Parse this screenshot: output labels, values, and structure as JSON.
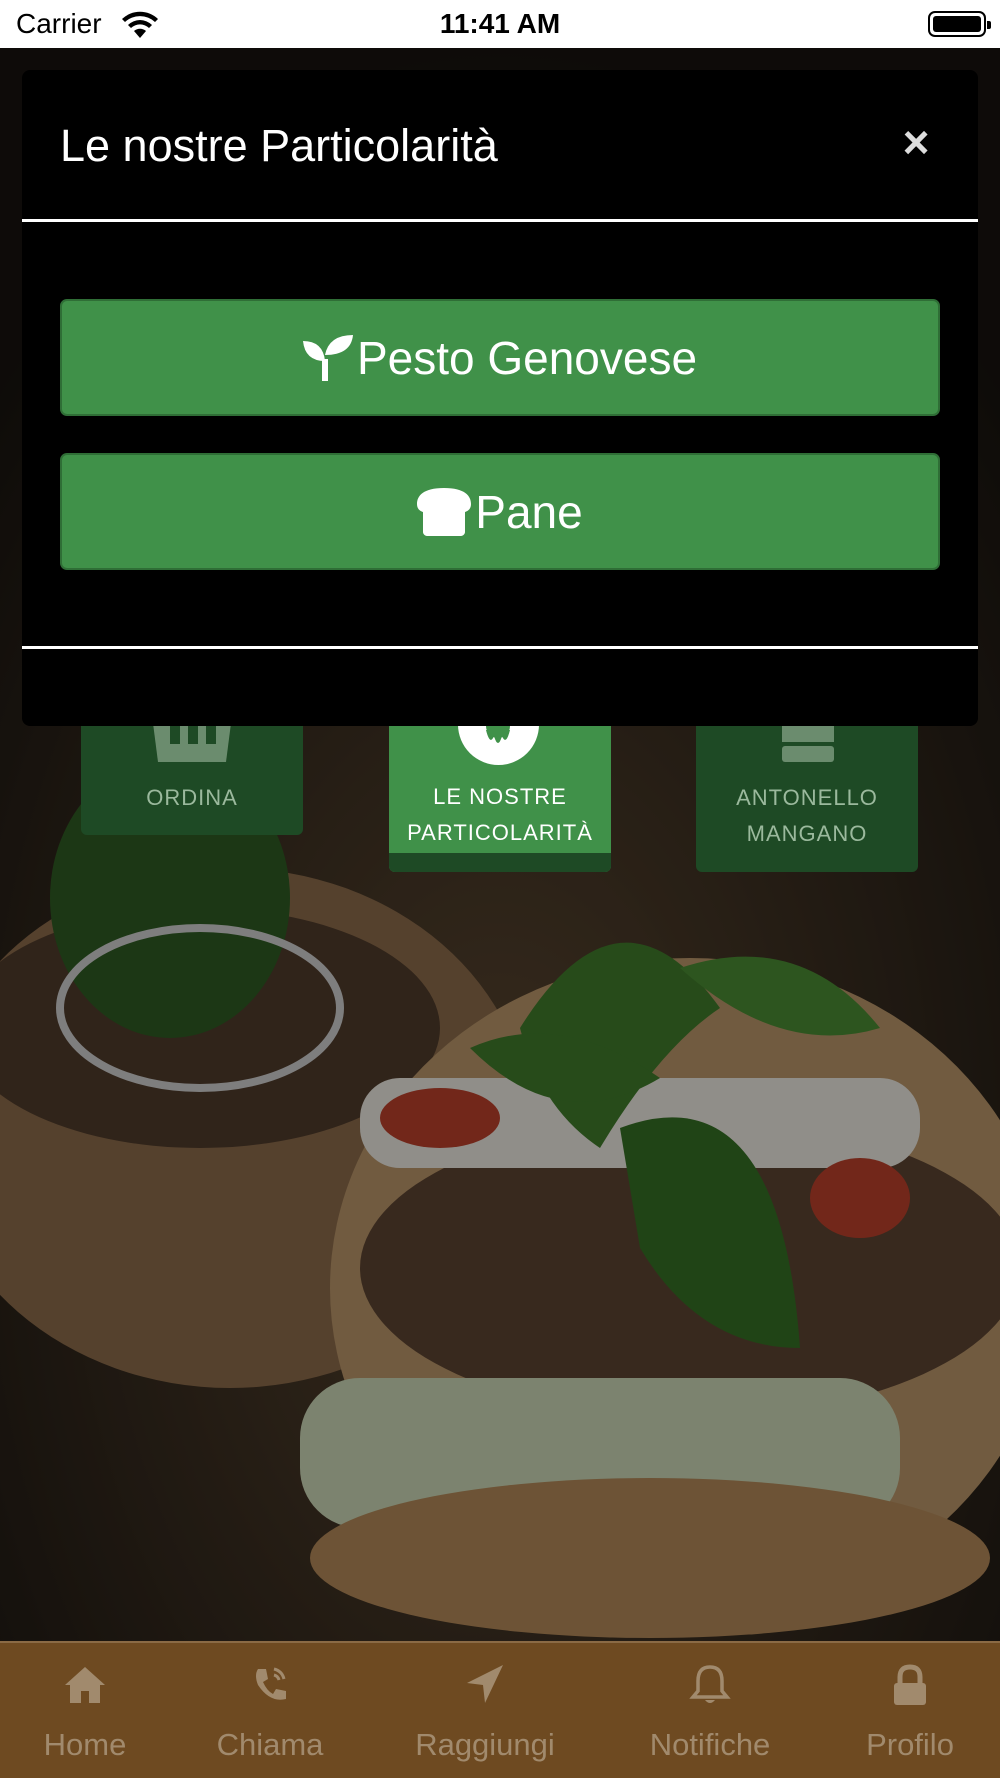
{
  "status_bar": {
    "carrier": "Carrier",
    "time": "11:41 AM"
  },
  "modal": {
    "title": "Le nostre Particolarità",
    "close_label": "×",
    "buttons": [
      {
        "label": "Pesto Genovese",
        "icon": "seedling-icon"
      },
      {
        "label": "Pane",
        "icon": "bread-icon"
      }
    ]
  },
  "tiles": [
    {
      "label": "ORDINA",
      "icon": "basket-icon",
      "active": false
    },
    {
      "label_line1": "LE NOSTRE",
      "label_line2": "PARTICOLARITÀ",
      "icon": "donut-icon",
      "active": true
    },
    {
      "label_line1": "ANTONELLO",
      "label_line2": "MANGANO",
      "icon": "chef-hat-icon",
      "active": false
    }
  ],
  "tab_bar": {
    "items": [
      {
        "label": "Home",
        "icon": "home-icon"
      },
      {
        "label": "Chiama",
        "icon": "phone-icon"
      },
      {
        "label": "Raggiungi",
        "icon": "location-arrow-icon"
      },
      {
        "label": "Notifiche",
        "icon": "bell-icon"
      },
      {
        "label": "Profilo",
        "icon": "lock-icon"
      }
    ]
  },
  "colors": {
    "accent_green": "#409149",
    "dark_green": "#1e4a25",
    "tab_bar_brown": "#6e4a21",
    "modal_bg": "#000000"
  }
}
